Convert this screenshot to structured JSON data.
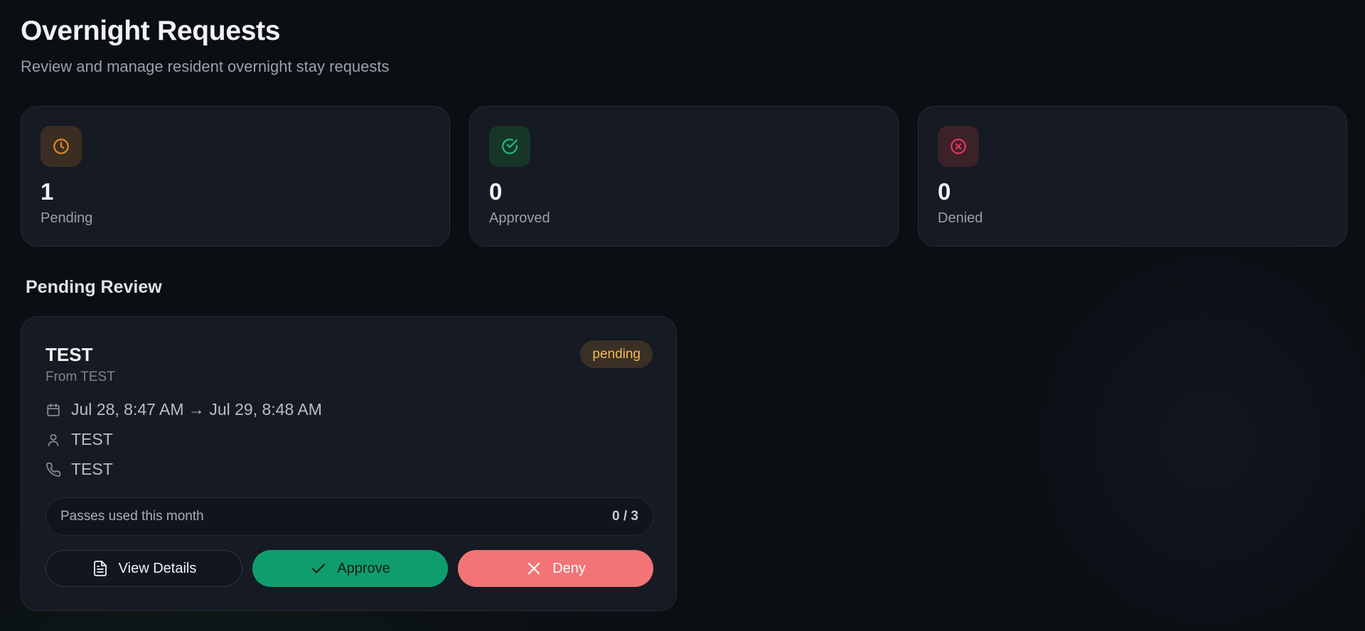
{
  "header": {
    "title": "Overnight Requests",
    "subtitle": "Review and manage resident overnight stay requests"
  },
  "stats": [
    {
      "value": "1",
      "label": "Pending",
      "icon": "clock-icon",
      "color": "#e08a2a",
      "bg": "#3a2e22"
    },
    {
      "value": "0",
      "label": "Approved",
      "icon": "check-circle-icon",
      "color": "#1fbf7d",
      "bg": "#173628"
    },
    {
      "value": "0",
      "label": "Denied",
      "icon": "x-circle-icon",
      "color": "#e8355e",
      "bg": "#3a2228"
    }
  ],
  "section": {
    "title": "Pending Review"
  },
  "request": {
    "name": "TEST",
    "from": "From TEST",
    "status": "pending",
    "dates": "Jul 28, 8:47 AM → Jul 29, 8:48 AM",
    "guest": "TEST",
    "phone": "TEST",
    "passes_label": "Passes used this month",
    "passes_count": "0 / 3"
  },
  "actions": {
    "details_label": "View Details",
    "approve_label": "Approve",
    "deny_label": "Deny"
  },
  "colors": {
    "approve": "#0f9d6e",
    "deny": "#f37476",
    "pending_badge": "#f5b95a"
  }
}
